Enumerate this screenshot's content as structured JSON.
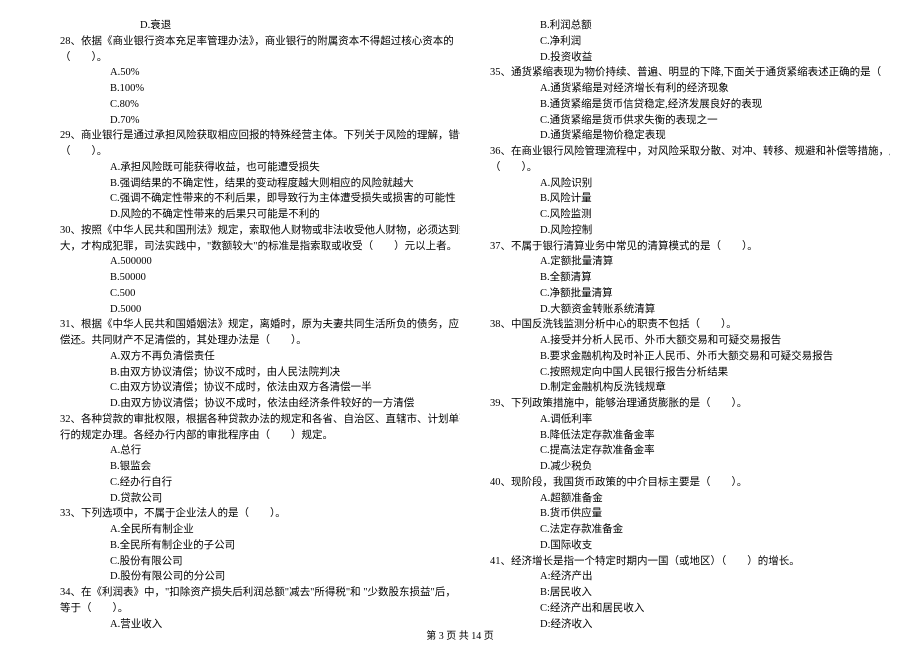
{
  "left": {
    "pre_d": "D.衰退",
    "q28": {
      "stem1": "28、依据《商业银行资本充足率管理办法》，商业银行的附属资本不得超过核心资本的",
      "stem2": "（　　）。",
      "a": "A.50%",
      "b": "B.100%",
      "c": "C.80%",
      "d": "D.70%"
    },
    "q29": {
      "stem1": "29、商业银行是通过承担风险获取相应回报的特殊经营主体。下列关于风险的理解，错误的是",
      "stem2": "（　　）。",
      "a": "A.承担风险既可能获得收益，也可能遭受损失",
      "b": "B.强调结果的不确定性，结果的变动程度越大则相应的风险就越大",
      "c": "C.强调不确定性带来的不利后果，即导致行为主体遭受损失或损害的可能性",
      "d": "D.风险的不确定性带来的后果只可能是不利的"
    },
    "q30": {
      "stem1": "30、按照《中华人民共和国刑法》规定，索取他人财物或非法收受他人财物，必须达到数额较",
      "stem2": "大，才构成犯罪，司法实践中，\"数额较大\"的标准是指索取或收受（　　）元以上者。",
      "a": "A.500000",
      "b": "B.50000",
      "c": "C.500",
      "d": "D.5000"
    },
    "q31": {
      "stem1": "31、根据《中华人民共和国婚姻法》规定，离婚时，原为夫妻共同生活所负的债务，应当共同",
      "stem2": "偿还。共同财产不足清偿的，其处理办法是（　　）。",
      "a": "A.双方不再负清偿责任",
      "b": "B.由双方协议清偿；协议不成时，由人民法院判决",
      "c": "C.由双方协议清偿；协议不成时，依法由双方各清偿一半",
      "d": "D.由双方协议清偿；协议不成时，依法由经济条件较好的一方清偿"
    },
    "q32": {
      "stem1": "32、各种贷款的审批权限，根据各种贷款办法的规定和各省、自治区、直辖市、计划单列市分",
      "stem2": "行的规定办理。各经办行内部的审批程序由（　　）规定。",
      "a": "A.总行",
      "b": "B.银监会",
      "c": "C.经办行自行",
      "d": "D.贷款公司"
    },
    "q33": {
      "stem1": "33、下列选项中，不属于企业法人的是（　　）。",
      "a": "A.全民所有制企业",
      "b": "B.全民所有制企业的子公司",
      "c": "C.股份有限公司",
      "d": "D.股份有限公司的分公司"
    },
    "q34": {
      "stem1": "34、在《利润表》中，\"扣除资产损失后利润总额\"减去\"所得税\"和 \"少数股东损益\"后，",
      "stem2": "等于（　　）。",
      "a": "A.营业收入"
    }
  },
  "right": {
    "pre_b": "B.利润总额",
    "pre_c": "C.净利润",
    "pre_d": "D.投资收益",
    "q35": {
      "stem1": "35、通货紧缩表现为物价持续、普遍、明显的下降,下面关于通货紧缩表述正确的是（　　）。",
      "a": "A.通货紧缩是对经济增长有利的经济现象",
      "b": "B.通货紧缩是货币信贷稳定,经济发展良好的表现",
      "c": "C.通货紧缩是货币供求失衡的表现之一",
      "d": "D.通货紧缩是物价稳定表现"
    },
    "q36": {
      "stem1": "36、在商业银行风险管理流程中，对风险采取分散、对冲、转移、规避和补偿等措施，属于",
      "stem2": "（　　）。",
      "a": "A.风险识别",
      "b": "B.风险计量",
      "c": "C.风险监测",
      "d": "D.风险控制"
    },
    "q37": {
      "stem1": "37、不属于银行清算业务中常见的清算模式的是（　　）。",
      "a": "A.定额批量清算",
      "b": "B.全额清算",
      "c": "C.净额批量清算",
      "d": "D.大额资金转账系统清算"
    },
    "q38": {
      "stem1": "38、中国反洗钱监测分析中心的职责不包括（　　）。",
      "a": "A.接受并分析人民币、外币大额交易和可疑交易报告",
      "b": "B.要求金融机构及时补正人民币、外币大额交易和可疑交易报告",
      "c": "C.按照规定向中国人民银行报告分析结果",
      "d": "D.制定金融机构反洗钱规章"
    },
    "q39": {
      "stem1": "39、下列政策措施中，能够治理通货膨胀的是（　　）。",
      "a": "A.调低利率",
      "b": "B.降低法定存款准备金率",
      "c": "C.提高法定存款准备金率",
      "d": "D.减少税负"
    },
    "q40": {
      "stem1": "40、现阶段，我国货币政策的中介目标主要是（　　）。",
      "a": "A.超额准备金",
      "b": "B.货币供应量",
      "c": "C.法定存款准备金",
      "d": "D.国际收支"
    },
    "q41": {
      "stem1": "41、经济增长是指一个特定时期内一国（或地区）（　　）的增长。",
      "a": "A:经济产出",
      "b": "B:居民收入",
      "c": "C:经济产出和居民收入",
      "d": "D:经济收入"
    }
  },
  "footer": "第 3 页 共 14 页"
}
